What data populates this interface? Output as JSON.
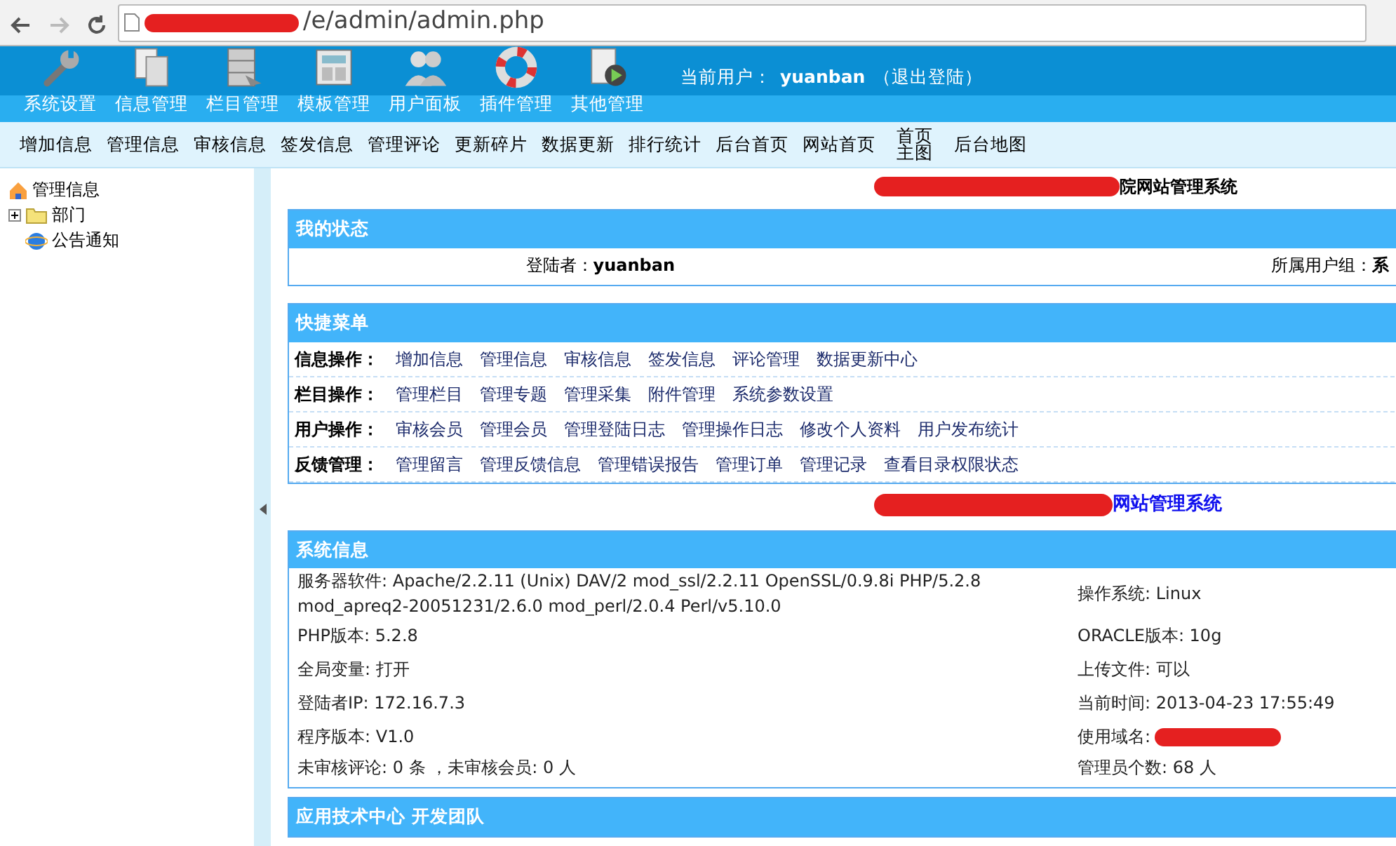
{
  "browser": {
    "url": "/e/admin/admin.php"
  },
  "top_nav": [
    {
      "label": "系统设置"
    },
    {
      "label": "信息管理"
    },
    {
      "label": "栏目管理"
    },
    {
      "label": "模板管理"
    },
    {
      "label": "用户面板"
    },
    {
      "label": "插件管理"
    },
    {
      "label": "其他管理"
    }
  ],
  "current_user": {
    "label": "当前用户：",
    "name": "yuanban",
    "logout": "（退出登陆）"
  },
  "sub_nav": [
    "增加信息",
    "管理信息",
    "审核信息",
    "签发信息",
    "管理评论",
    "更新碎片",
    "数据更新",
    "排行统计",
    "后台首页",
    "网站首页",
    "首页主图",
    "后台地图"
  ],
  "tree": {
    "label": "管理信息",
    "children": [
      {
        "label": "部门",
        "kind": "folder",
        "expanded": false
      },
      {
        "label": "公告通知",
        "kind": "page"
      }
    ]
  },
  "site_title": "院网站管理系统",
  "status_panel": {
    "title": "我的状态",
    "login_label": "登陆者：",
    "login_user": "yuanban",
    "group_label": "所属用户组：",
    "group_value": "系"
  },
  "quick_menu": {
    "title": "快捷菜单",
    "rows": [
      {
        "label": "信息操作：",
        "links": [
          "增加信息",
          "管理信息",
          "审核信息",
          "签发信息",
          "评论管理",
          "数据更新中心"
        ]
      },
      {
        "label": "栏目操作：",
        "links": [
          "管理栏目",
          "管理专题",
          "管理采集",
          "附件管理",
          "系统参数设置"
        ]
      },
      {
        "label": "用户操作：",
        "links": [
          "审核会员",
          "管理会员",
          "管理登陆日志",
          "管理操作日志",
          "修改个人资料",
          "用户发布统计"
        ]
      },
      {
        "label": "反馈管理：",
        "links": [
          "管理留言",
          "管理反馈信息",
          "管理错误报告",
          "管理订单",
          "管理记录",
          "查看目录权限状态"
        ]
      }
    ]
  },
  "site_title_2": "网站管理系统",
  "system_info": {
    "title": "系统信息",
    "rows": [
      {
        "left": "服务器软件: Apache/2.2.11 (Unix) DAV/2 mod_ssl/2.2.11 OpenSSL/0.9.8i PHP/5.2.8 mod_apreq2-20051231/2.6.0 mod_perl/2.0.4 Perl/v5.10.0",
        "right": "操作系统: Linux"
      },
      {
        "left": "PHP版本: 5.2.8",
        "right": "ORACLE版本: 10g"
      },
      {
        "left": "全局变量: 打开",
        "right": "上传文件: 可以"
      },
      {
        "left": "登陆者IP: 172.16.7.3",
        "right": "当前时间: 2013-04-23 17:55:49"
      },
      {
        "left": "程序版本: V1.0",
        "right": "使用域名:",
        "redacted": true
      },
      {
        "left": "未审核评论: 0 条 ，未审核会员: 0 人",
        "right": "管理员个数:  68 人"
      }
    ]
  },
  "team_panel": {
    "title": "应用技术中心 开发团队"
  }
}
